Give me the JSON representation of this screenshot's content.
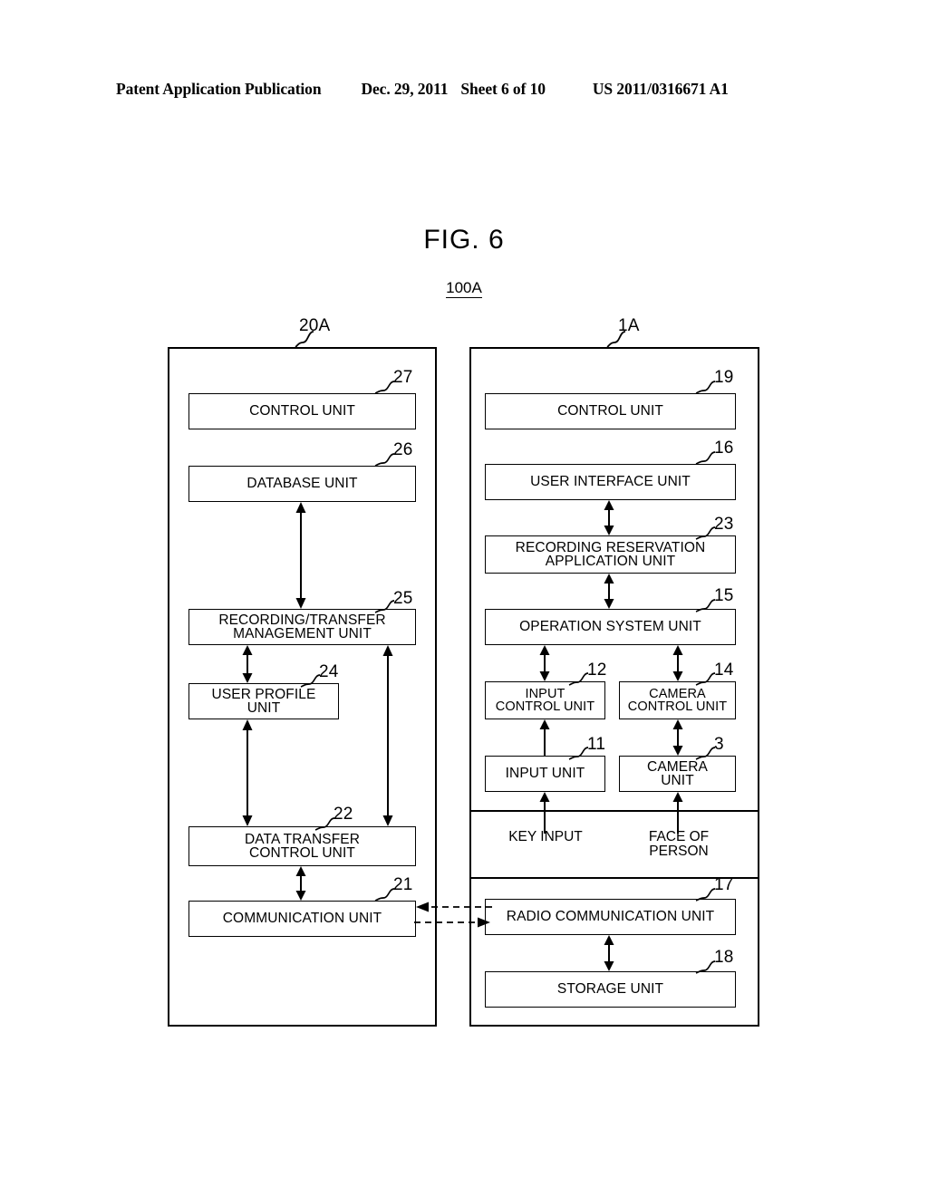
{
  "header": {
    "publication": "Patent Application Publication",
    "date": "Dec. 29, 2011",
    "sheet": "Sheet 6 of 10",
    "number": "US 2011/0316671 A1"
  },
  "figure": {
    "title": "FIG. 6",
    "system_ref": "100A"
  },
  "panels": {
    "server": {
      "ref": "20A",
      "boxes": [
        {
          "ref": "27",
          "label": "CONTROL UNIT"
        },
        {
          "ref": "26",
          "label": "DATABASE UNIT"
        },
        {
          "ref": "25",
          "label": "RECORDING/TRANSFER\nMANAGEMENT UNIT"
        },
        {
          "ref": "24",
          "label": "USER PROFILE\nUNIT"
        },
        {
          "ref": "22",
          "label": "DATA TRANSFER\nCONTROL UNIT"
        },
        {
          "ref": "21",
          "label": "COMMUNICATION UNIT"
        }
      ]
    },
    "device": {
      "ref": "1A",
      "boxes": [
        {
          "ref": "19",
          "label": "CONTROL UNIT"
        },
        {
          "ref": "16",
          "label": "USER INTERFACE UNIT"
        },
        {
          "ref": "23",
          "label": "RECORDING RESERVATION\nAPPLICATION UNIT"
        },
        {
          "ref": "15",
          "label": "OPERATION SYSTEM UNIT"
        },
        {
          "ref": "12",
          "label": "INPUT\nCONTROL UNIT"
        },
        {
          "ref": "14",
          "label": "CAMERA\nCONTROL UNIT"
        },
        {
          "ref": "11",
          "label": "INPUT UNIT"
        },
        {
          "ref": "3",
          "label": "CAMERA\nUNIT"
        },
        {
          "ref": "17",
          "label": "RADIO COMMUNICATION UNIT"
        },
        {
          "ref": "18",
          "label": "STORAGE UNIT"
        }
      ],
      "signals": [
        {
          "label": "KEY INPUT"
        },
        {
          "label": "FACE OF\nPERSON"
        }
      ]
    }
  },
  "colors": {
    "ink": "#000000",
    "paper": "#ffffff"
  }
}
